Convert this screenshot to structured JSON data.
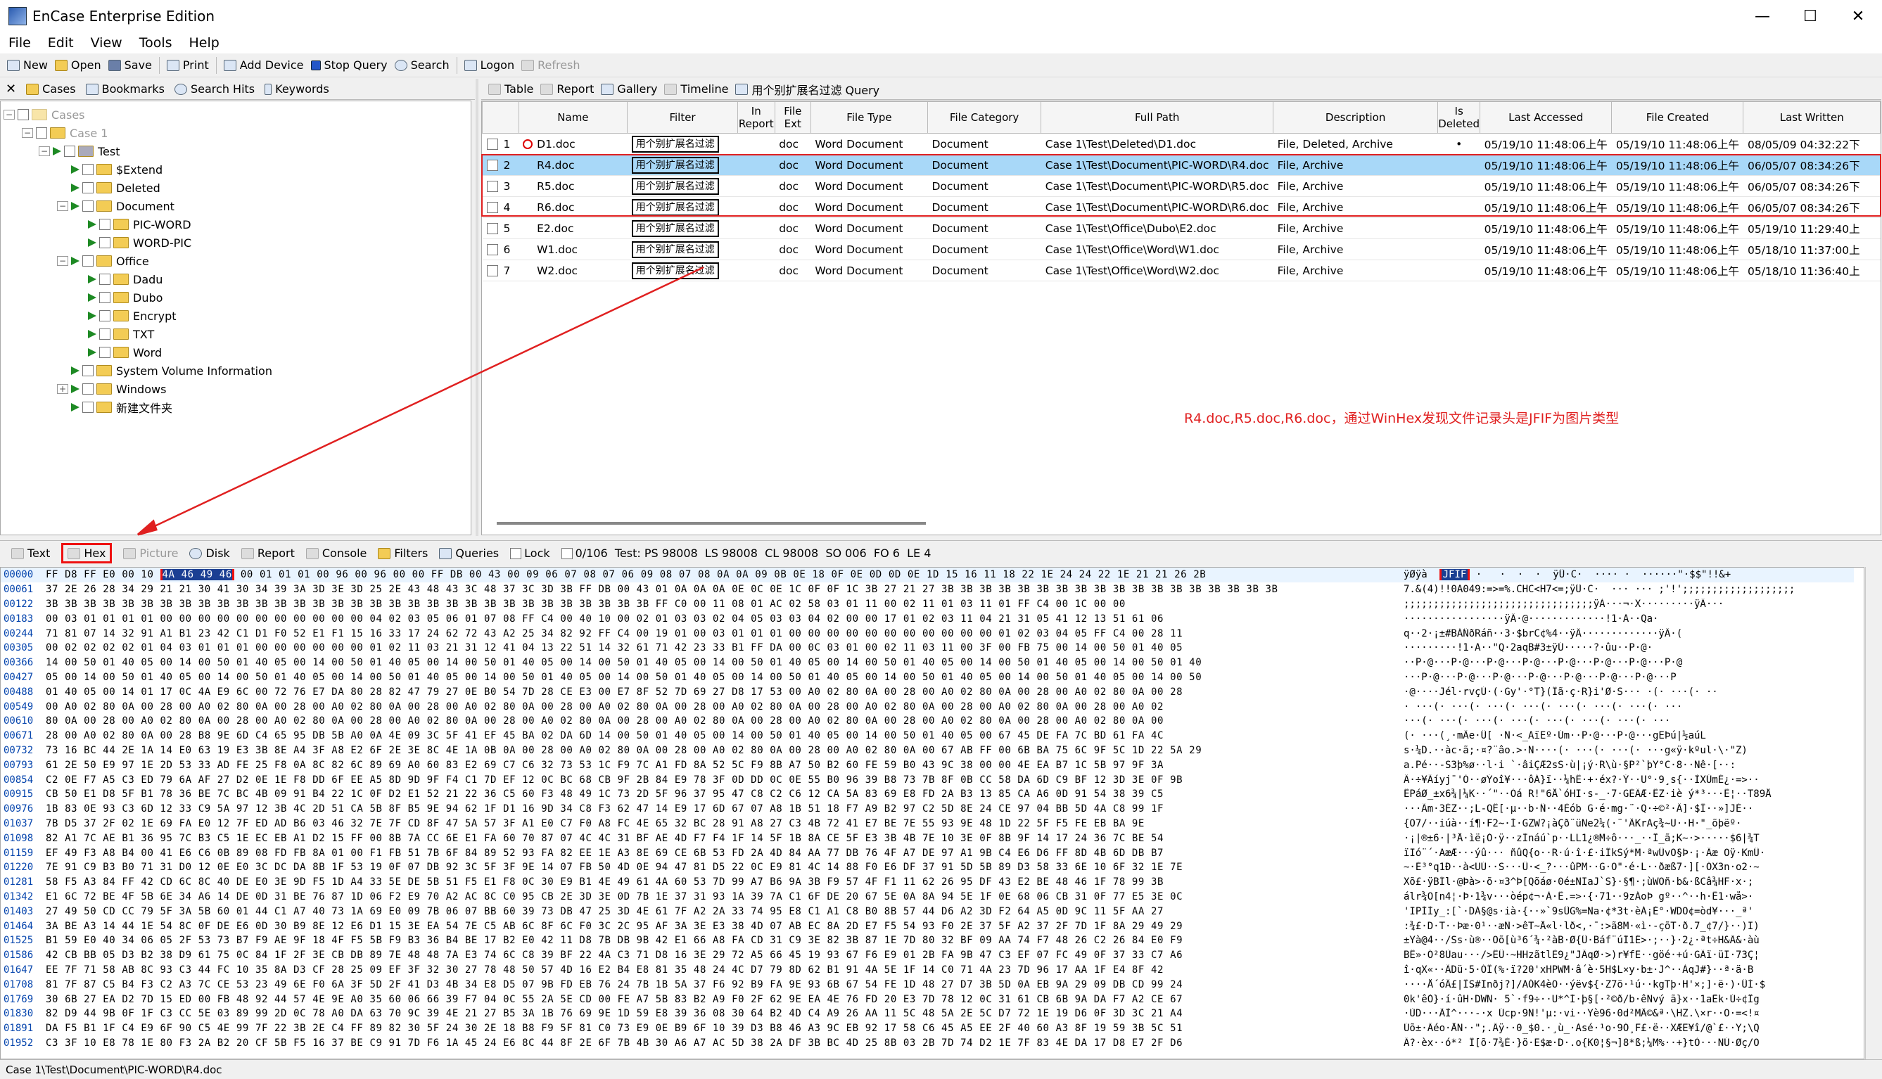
{
  "window": {
    "title": "EnCase Enterprise Edition"
  },
  "menu": [
    "File",
    "Edit",
    "View",
    "Tools",
    "Help"
  ],
  "toolbar": {
    "new": "New",
    "open": "Open",
    "save": "Save",
    "print": "Print",
    "add_device": "Add Device",
    "stop_query": "Stop Query",
    "search": "Search",
    "logon": "Logon",
    "refresh": "Refresh"
  },
  "left_tabs": {
    "cases": "Cases",
    "bookmarks": "Bookmarks",
    "search_hits": "Search Hits",
    "keywords": "Keywords"
  },
  "tree": [
    {
      "label": "Cases",
      "dim": true
    },
    {
      "label": "Case 1",
      "dim": true
    },
    {
      "label": "Test"
    },
    {
      "label": "$Extend"
    },
    {
      "label": "Deleted"
    },
    {
      "label": "Document"
    },
    {
      "label": "PIC-WORD"
    },
    {
      "label": "WORD-PIC"
    },
    {
      "label": "Office"
    },
    {
      "label": "Dadu"
    },
    {
      "label": "Dubo"
    },
    {
      "label": "Encrypt"
    },
    {
      "label": "TXT"
    },
    {
      "label": "Word"
    },
    {
      "label": "System Volume Information"
    },
    {
      "label": "Windows"
    },
    {
      "label": "新建文件夹"
    }
  ],
  "right_tabs": {
    "table": "Table",
    "report": "Report",
    "gallery": "Gallery",
    "timeline": "Timeline",
    "query": "用个别扩展名过滤 Query"
  },
  "columns": [
    "",
    "Name",
    "Filter",
    "In Report",
    "File Ext",
    "File Type",
    "File Category",
    "Full Path",
    "Description",
    "Is Deleted",
    "Last Accessed",
    "File Created",
    "Last Written"
  ],
  "rows": [
    {
      "n": "1",
      "name": "D1.doc",
      "filter": "用个别扩展名过滤",
      "ext": "doc",
      "type": "Word Document",
      "cat": "Document",
      "path": "Case 1\\Test\\Deleted\\D1.doc",
      "desc": "File, Deleted, Archive",
      "del": "•",
      "acc": "05/19/10 11:48:06上午",
      "cre": "05/19/10 11:48:06上午",
      "wri": "08/05/09 04:32:22下"
    },
    {
      "n": "2",
      "name": "R4.doc",
      "filter": "用个别扩展名过滤",
      "ext": "doc",
      "type": "Word Document",
      "cat": "Document",
      "path": "Case 1\\Test\\Document\\PIC-WORD\\R4.doc",
      "desc": "File, Archive",
      "del": "",
      "acc": "05/19/10 11:48:06上午",
      "cre": "05/19/10 11:48:06上午",
      "wri": "06/05/07 08:34:26下"
    },
    {
      "n": "3",
      "name": "R5.doc",
      "filter": "用个别扩展名过滤",
      "ext": "doc",
      "type": "Word Document",
      "cat": "Document",
      "path": "Case 1\\Test\\Document\\PIC-WORD\\R5.doc",
      "desc": "File, Archive",
      "del": "",
      "acc": "05/19/10 11:48:06上午",
      "cre": "05/19/10 11:48:06上午",
      "wri": "06/05/07 08:34:26下"
    },
    {
      "n": "4",
      "name": "R6.doc",
      "filter": "用个别扩展名过滤",
      "ext": "doc",
      "type": "Word Document",
      "cat": "Document",
      "path": "Case 1\\Test\\Document\\PIC-WORD\\R6.doc",
      "desc": "File, Archive",
      "del": "",
      "acc": "05/19/10 11:48:06上午",
      "cre": "05/19/10 11:48:06上午",
      "wri": "06/05/07 08:34:26下"
    },
    {
      "n": "5",
      "name": "E2.doc",
      "filter": "用个别扩展名过滤",
      "ext": "doc",
      "type": "Word Document",
      "cat": "Document",
      "path": "Case 1\\Test\\Office\\Dubo\\E2.doc",
      "desc": "File, Archive",
      "del": "",
      "acc": "05/19/10 11:48:06上午",
      "cre": "05/19/10 11:48:06上午",
      "wri": "05/19/10 11:29:40上"
    },
    {
      "n": "6",
      "name": "W1.doc",
      "filter": "用个别扩展名过滤",
      "ext": "doc",
      "type": "Word Document",
      "cat": "Document",
      "path": "Case 1\\Test\\Office\\Word\\W1.doc",
      "desc": "File, Archive",
      "del": "",
      "acc": "05/19/10 11:48:06上午",
      "cre": "05/19/10 11:48:06上午",
      "wri": "05/18/10 11:37:00上"
    },
    {
      "n": "7",
      "name": "W2.doc",
      "filter": "用个别扩展名过滤",
      "ext": "doc",
      "type": "Word Document",
      "cat": "Document",
      "path": "Case 1\\Test\\Office\\Word\\W2.doc",
      "desc": "File, Archive",
      "del": "",
      "acc": "05/19/10 11:48:06上午",
      "cre": "05/19/10 11:48:06上午",
      "wri": "05/18/10 11:36:40上"
    }
  ],
  "annotation": "R4.doc,R5.doc,R6.doc，通过WinHex发现文件记录头是JFIF为图片类型",
  "bottom_tabs": {
    "text": "Text",
    "hex": "Hex",
    "picture": "Picture",
    "disk": "Disk",
    "report": "Report",
    "console": "Console",
    "filters": "Filters",
    "queries": "Queries",
    "lock": "Lock",
    "status": "0/106  Test: PS 98008  LS 98008  CL 98008  SO 006  FO 6  LE 4"
  },
  "hex": {
    "first_row": {
      "off": "00000",
      "pre": "FF D8 FF E0 00 10 ",
      "hl": "4A 46 49 46",
      "post": " 00 01 01 01 00 96 00 96 00 00 FF DB 00 43 00 09 06 07 08 07 06 09 08 07 08 0A 0A 09 0B 0E 18 0F 0E 0D 0D 0E 1D 15 16 11 18 22 1E 24 24 22 1E 21 21 26 2B",
      "asc_pre": "ÿØÿà  ",
      "asc_hl": "JFIF",
      "asc_post": " ·   ·  ·  ·  ÿÛ·C·  ···· ·  ······\"·$$\"!!&+"
    },
    "rows": [
      {
        "off": "00061",
        "b": "37 2E 26 28 34 29 21 21 30 41 30 34 39 3A 3D 3E 3D 25 2E 43 48 43 3C 48 37 3C 3D 3B FF DB 00 43 01 0A 0A 0A 0E 0C 0E 1C 0F 0F 1C 3B 27 21 27 3B 3B 3B 3B 3B 3B 3B 3B 3B 3B 3B 3B 3B 3B 3B 3B 3B 3B",
        "a": "7.&(4)!!0A049:=>=%.CHC<H7<=;ÿÛ·C·  ··· ··· ;'!';;;;;;;;;;;;;;;;;;;"
      },
      {
        "off": "00122",
        "b": "3B 3B 3B 3B 3B 3B 3B 3B 3B 3B 3B 3B 3B 3B 3B 3B 3B 3B 3B 3B 3B 3B 3B 3B 3B 3B 3B 3B 3B 3B 3B 3B FF C0 00 11 08 01 AC 02 58 03 01 11 00 02 11 01 03 11 01 FF C4 00 1C 00 00",
        "a": ";;;;;;;;;;;;;;;;;;;;;;;;;;;;;;;;ÿÀ···¬·X·········ÿÄ···"
      },
      {
        "off": "00183",
        "b": "00 03 01 01 01 01 00 00 00 00 00 00 00 00 00 00 00 04 02 03 05 06 01 07 08 FF C4 00 40 10 00 02 01 03 03 02 04 05 03 03 04 02 00 00 17 01 02 03 11 04 21 31 05 41 12 13 51 61 06",
        "a": "·················ÿÄ·@·············!1·A··Qa·"
      },
      {
        "off": "00244",
        "b": "71 81 07 14 32 91 A1 B1 23 42 C1 D1 F0 52 E1 F1 15 16 33 17 24 62 72 43 A2 25 34 82 92 FF C4 00 19 01 00 03 01 01 01 00 00 00 00 00 00 00 00 00 00 00 01 02 03 04 05 FF C4 00 28 11",
        "a": "q··2·¡±#BÁÑðRáñ··3·$brC¢%4··ÿÄ·············ÿÄ·("
      },
      {
        "off": "00305",
        "b": "00 02 02 02 02 01 04 03 01 01 01 00 00 00 00 00 00 01 02 11 03 21 31 12 41 04 13 22 51 14 32 61 71 42 23 33 B1 FF DA 00 0C 03 01 00 02 11 03 11 00 3F 00 FB 75 00 14 00 50 01 40 05",
        "a": "·········!1·A··\"Q·2aqB#3±ÿÚ·····?·ûu··P·@·"
      },
      {
        "off": "00366",
        "b": "14 00 50 01 40 05 00 14 00 50 01 40 05 00 14 00 50 01 40 05 00 14 00 50 01 40 05 00 14 00 50 01 40 05 00 14 00 50 01 40 05 00 14 00 50 01 40 05 00 14 00 50 01 40 05 00 14 00 50 01 40",
        "a": "··P·@···P·@···P·@···P·@···P·@···P·@···P·@···P·@"
      },
      {
        "off": "00427",
        "b": "05 00 14 00 50 01 40 05 00 14 00 50 01 40 05 00 14 00 50 01 40 05 00 14 00 50 01 40 05 00 14 00 50 01 40 05 00 14 00 50 01 40 05 00 14 00 50 01 40 05 00 14 00 50 01 40 05 00 14 00 50",
        "a": "···P·@···P·@···P·@···P·@···P·@···P·@···P·@···P"
      },
      {
        "off": "00488",
        "b": "01 40 05 00 14 01 17 0C 4A E9 6C 00 72 76 E7 DA 80 28 82 47 79 27 0E B0 54 7D 28 CE E3 00 E7 8F 52 7D 69 27 D8 17 53 00 A0 02 80 0A 00 28 00 A0 02 80 0A 00 28 00 A0 02 80 0A 00 28",
        "a": "·@····Jél·rvçÚ·(·Gy'·°T}(Îã·ç·R}i'Ø·S··· ·(· ···(· ··"
      },
      {
        "off": "00549",
        "b": "00 A0 02 80 0A 00 28 00 A0 02 80 0A 00 28 00 A0 02 80 0A 00 28 00 A0 02 80 0A 00 28 00 A0 02 80 0A 00 28 00 A0 02 80 0A 00 28 00 A0 02 80 0A 00 28 00 A0 02 80 0A 00 28 00 A0 02",
        "a": "· ···(· ···(· ···(· ···(· ···(· ···(· ···(· ···"
      },
      {
        "off": "00610",
        "b": "80 0A 00 28 00 A0 02 80 0A 00 28 00 A0 02 80 0A 00 28 00 A0 02 80 0A 00 28 00 A0 02 80 0A 00 28 00 A0 02 80 0A 00 28 00 A0 02 80 0A 00 28 00 A0 02 80 0A 00 28 00 A0 02 80 0A 00",
        "a": "···(· ···(· ···(· ···(· ···(· ···(· ···(· ···"
      },
      {
        "off": "00671",
        "b": "28 00 A0 02 80 0A 00 28 B8 9E 6D C4 65 95 DB 5B A0 0A 4E 09 3C 5F 41 EF 45 BA 02 DA 6D 14 00 50 01 40 05 00 14 00 50 01 40 05 00 14 00 50 01 40 05 00 67 45 DE FA 7C BD 61 FA 4C",
        "a": "(· ···(¸·mÄe·Û[ ·N·<_AïEº·Úm··P·@···P·@···gEÞú|½aúL"
      },
      {
        "off": "00732",
        "b": "73 16 BC 44 2E 1A 14 E0 63 19 E3 3B 8E A4 3F A8 E2 6F 2E 3E 8C 4E 1A 0B 0A 00 28 00 A0 02 80 0A 00 28 00 A0 02 80 0A 00 28 00 A0 02 80 0A 00 67 AB FF 00 6B BA 75 6C 9F 5C 1D 22 5A 29",
        "a": "s·¼D.··àc·ã;·¤?¨âo.>·N····(· ···(· ···(· ···g«ÿ·kºul·\\·\"Z)"
      },
      {
        "off": "00793",
        "b": "61 2E 50 E9 97 1E 2D 53 33 AD FE 25 F8 0A 8C 82 6C 89 69 A0 60 83 E2 69 C7 C6 32 73 53 1C F9 7C A1 FD 8A 52 5C F9 8B A7 50 B2 60 FE 59 B0 43 9C 38 00 00 4E EA B7 1C 5B 97 9F 3A",
        "a": "a.Pé··-S3­þ%ø··l·i `·âiÇÆ2sS·ù|¡ý·R\\ù·§P²`þY°C·8··Nê·[··:"
      },
      {
        "off": "00854",
        "b": "C2 0E F7 A5 C3 ED 79 6A AF 27 D2 0E 1E F8 DD 6F EE A5 8D 9D 9F F4 C1 7D EF 12 0C BC 68 CB 9F 2B 84 E9 78 3F 0D DD 0C 0E 55 B0 96 39 B8 73 7B 8F 0B CC 58 DA 6D C9 BF 12 3D 3E 0F 9B",
        "a": "Â·÷¥Ãíyj¯'Ò··øÝoî¥···ôÁ}ï··¼hË·+·éx?·Ý··U°·9¸s{··ÌXÚmÉ¿·=>··"
      },
      {
        "off": "00915",
        "b": "CB 50 E1 D8 5F B1 78 36 BE 7C BC 4B 09 91 B4 22 1C 0F D2 E1 52 21 22 36 C5 60 F3 48 49 1C 73 2D 5F 96 37 95 47 C8 C2 C6 12 CA 5A 83 69 E8 FD 2A B3 13 85 CA A6 0D 91 54 38 39 C5",
        "a": "ËPáØ_±x6¾|¼K··´\"··Òá R!\"6Å`óHI·s-_·7·GÈÂÆ·ÊZ·iè ý*³···Ê¦··T89Å"
      },
      {
        "off": "00976",
        "b": "1B 83 0E 93 C3 6D 12 33 C9 5A 97 12 3B 4C 2D 51 CA 5B 8F B5 9E 94 62 1F D1 16 9D 34 C8 F3 62 47 14 E9 17 6D 67 07 A8 1B 51 18 F7 A9 B2 97 C2 5D 8E 24 CE 97 04 BB 5D 4A C8 99 1F",
        "a": "···Ãm·3ÉZ··;L-QÊ[·µ··b·Ñ··4Èób G·é·mg·¨·Q·÷©²·Â]·$Î··»]JÈ··"
      },
      {
        "off": "01037",
        "b": "7B D5 37 2F 02 1E 69 FA E0 12 7F ED AD B6 03 46 32 7E 7F CD 8F 47 5A 57 3F A1 E0 C7 F0 A8 FC 4E 65 32 BC 28 91 A8 27 C3 4B 72 41 E7 BE 7E 55 93 9E 48 1D 22 5F F5 FE EB BA 9E",
        "a": "{Õ7/··iúà··í­¶·F2~·Í·GZW?¡àÇð¨üNe2¼(·¨'ÃKrAç¾~U··H·\"_õþëº·"
      },
      {
        "off": "01098",
        "b": "82 A1 7C AE B1 36 95 7C B3 C5 1E EC EB A1 D2 15 FF 00 8B 7A CC 6E E1 FA 60 70 87 07 4C 4C 31 BF AE 4D F7 F4 1F 14 5F 1B 8A CE 5F E3 3B 4B 7E 10 3E 0F 8B 9F 14 17 24 36 7C BE 54",
        "a": "·¡|®±6·|³Å·ìë¡Ò·ÿ··zÌnáú`p··LL1¿®M÷ô···_··Î_ã;K~·>·····$6|¾T"
      },
      {
        "off": "01159",
        "b": "EF 49 F3 A8 B4 00 41 E6 C6 0B 89 08 FD FB 8A 01 00 F1 FB 51 7B 6F 84 89 52 93 FA 82 EE 1E A3 8E 69 CE 6B 53 FD 2A 4D 84 AA 77 DB 76 4F A7 DE 97 A1 9B C4 E6 D6 FF 8D 4B 6D DB B7",
        "a": "ïIó¨´·AæÆ···ýû··· ñûQ{o··R·ú·î·£·iÎkSý*M·ªwÛvO§Þ·¡·Äæ Öÿ·KmÛ·"
      },
      {
        "off": "01220",
        "b": "7E 91 C9 B3 B0 71 31 D0 12 0E E0 3C DC DA 8B 1F 53 19 0F 07 DB 92 3C 5F 3F 9E 14 07 FB 50 4D 0E 94 47 81 D5 22 0C E9 81 4C 14 88 F0 E6 DF 37 91 5D 5B 89 D3 58 33 6E 10 6F 32 1E 7E",
        "a": "~·É³°q1Ð··à<ÜÚ··S···Û·<_?···ûPM··G·Õ\"·é·L··ðæß7·][·ÓX3n·o2·~"
      },
      {
        "off": "01281",
        "b": "58 F5 A3 84 FF 42 CD 6C 8C 40 DE E0 3E 9D F5 1D A4 33 5E DE 5B 51 F5 E1 F8 0C 30 E9 B1 4E 49 61 4A 60 53 7D 99 A7 B6 9A 3B F9 57 4F F1 11 62 26 95 DF 43 E2 BE 48 46 1F 78 99 3B",
        "a": "Xõ£·ÿBÍl·@Þà>·õ·¤3^Þ[Qõáø·0é±NIaJ`S}·§¶·;ùWOñ·b&·ßCâ¾HF·x·;"
      },
      {
        "off": "01342",
        "b": "E1 6C 72 BE 4F 5B 6E 34 A6 14 DE 0D 31 BE 76 87 1D 06 F2 E9 70 A2 AC 8C C0 95 CB 2E 3D 3E 0D 7B 1E 37 31 93 1A 39 7A C1 6F DE 20 67 5E 0A 8A 94 5E 1F 0E 68 06 CB 31 0F 77 E5 3E 0C",
        "a": "álr¾O[n4¦·Þ·1¾v···òép¢¬·À·Ë.=>·{·71··9zÁoÞ gº··^··h·Ë1·wå>·"
      },
      {
        "off": "01403",
        "b": "27 49 50 CD CC 79 5F 3A 5B 60 01 44 C1 A7 40 73 1A 69 E0 09 7B 06 07 BB 60 39 73 DB 47 25 3D 4E 61 7F A2 2A 33 74 95 E8 C1 A1 C8 B0 8B 57 44 D6 A2 3D F2 64 A5 0D 9C 11 5F AA 27",
        "a": "'IPÍÌy_:[`·DÁ§@s·ià·{··»`9sÛG%=Na·¢*3t·èÁ¡È°·WDÖ¢=òd¥···_ª'"
      },
      {
        "off": "01464",
        "b": "3A BE A3 14 44 1E 54 8C 0F DE E6 0D 30 B9 8E 12 E6 D1 15 3E EA 54 7E C5 AB 6C 8F 6C F0 3C 2C 95 AF 3A 3E E3 38 4D 07 AB EC 8A 2D E7 F5 54 93 F0 2E 37 5F A2 37 2F 7D 1F 8A 29 49 29",
        "a": ":¾£·D·T··Þæ·0¹··æÑ·>êT~Å«l·lð<,·¯:>ã8M·«ì·-çõT·ð.7_¢7/}··)I)"
      },
      {
        "off": "01525",
        "b": "B1 59 E0 40 34 06 05 2F 53 73 B7 F9 AE 9F 18 4F F5 5B F9 B3 36 B4 BE 17 B2 E0 42 11 D8 7B DB 9B 42 E1 66 A8 FA CD 31 C9 3E 82 3B 87 1E 7D 80 32 BF 09 AA 74 F7 48 26 C2 26 84 E0 F9",
        "a": "±Yà@4··/Ss·ù®··Oõ[ù³6´¾·²àB·Ø{Û·Báf¨úÍ1É>·;··}·2¿·ªt÷H&Â&·àù"
      },
      {
        "off": "01586",
        "b": "42 CB BB 05 D3 B2 38 D9 61 75 0C 84 1F 2F 3E CB DB 89 7E 48 48 7A E3 74 6C C8 39 BF 22 4A C3 71 D8 16 3E 29 72 A5 66 45 19 93 67 F6 E9 01 2B FA 9B 47 C3 EF 07 FC 49 0F 37 33 C7 A6",
        "a": "BË»·Ó²8Ùau···/>ËÛ·~HHzãtlÈ9¿\"JÃqØ·>)r¥fE··göé·+ú·GÃï·üI·73Ç¦"
      },
      {
        "off": "01647",
        "b": "EE 7F 71 58 AB 8C 93 C3 44 FC 10 35 8A D3 CF 28 25 09 EF 3F 32 30 27 78 48 50 57 4D 16 E2 B4 E8 81 35 48 24 4C D7 79 8D 62 B1 91 4A 5E 1F 14 C0 71 4A 23 7D 96 17 AA 1F E4 8F 42",
        "a": "î·qX«··ÃDü·5·ÓÏ(%·ï?20'xHPWM·â´è·5H$L×y·b±·J^··ÀqJ#}··ª·ä·B"
      },
      {
        "off": "01708",
        "b": "81 7F 87 C5 B4 F3 C2 A3 7C CE 53 23 49 6E F0 6A 3F 5D 2F 41 D3 4B 34 E8 D5 07 9B FD EB 76 24 7B 1B 5A 37 F6 92 B9 FA 9E 93 6B 67 54 FE 1D 48 27 D7 3B 5D 0A EB 9A 29 09 DB CD 99 24",
        "a": "····Å´óÂ£|ÎS#Inðj?]/AÓK4èÕ··ýëv${·Z7ö·¹ú··kgTþ·H'×;]·ë·)·ÛÍ·$"
      },
      {
        "off": "01769",
        "b": "30 6B 27 EA D2 7D 15 ED 00 FB 48 92 44 57 4E 9E A0 35 60 06 66 39 F7 04 0C 55 2A 5E CD 00 FE A7 5B 83 B2 A9 F0 2F 62 9E EA 4E 76 FD 20 E3 7D 78 12 0C 31 61 CB 6B 9A DA F7 A2 CE 67",
        "a": "0k'êÒ}·í·ûH·DWN· 5`·f9÷··U*^Í·þ§[·²©ð/b·êNvý ã}x··1aËk·Ú÷¢Îg"
      },
      {
        "off": "01830",
        "b": "82 D9 44 9B 0F 1F C3 CC 5E 03 89 99 2D 0C 78 A0 DA 63 70 9C 39 4E 21 27 B5 3A 1B 76 69 9E 1D 59 E8 39 36 08 30 64 B2 4D C4 A9 26 AA 11 5C 48 5A 2E 5C D7 72 1E 19 D6 0F 3D 3C 21 A4",
        "a": "·ÙD···ÃÌ^···-·x Úcp·9N!'µ:·vi··Yè96·0d²MÄ©&ª·\\HZ.\\×r··Ö·=<!¤"
      },
      {
        "off": "01891",
        "b": "DA F5 B1 1F C4 E9 6F 90 C5 4E 99 7F 22 3B 2E C4 FF 89 82 30 5F 24 30 2E 18 B8 F9 5F 81 C0 73 E9 0E B9 6F 10 39 D3 B8 46 A3 9C EB 92 17 58 C6 45 A5 EE 2F 40 60 A3 8F 19 59 3B 5C 51",
        "a": "Úõ±·Äéo·ÅN··\";.Äÿ··0_$0.·¸ù_·Àsé·¹o·9Ó¸F£·ë··XÆE¥î/@`£··Y;\\Q"
      },
      {
        "off": "01952",
        "b": "C3 3F 10 E8 78 1E 80 F3 2A B2 20 CF 5B F5 16 37 BE C9 91 7D F6 1A 45 24 E6 8C 44 8F 2E 6F 7B 4B 30 A6 A7 AC 5D 38 2A DF 3B BC 4D 25 8B 03 2B 7D 74 D2 1E 7F 83 4E DA 17 D8 E7 2F D6",
        "a": "Ã?·èx··ó*² Ï[õ·7¾É·}ö·E$æ·D·.o{K0¦§¬]8*ß;¼M%··+}tÒ···NÚ·Øç/Ö"
      }
    ]
  },
  "status": {
    "path": "Case 1\\Test\\Document\\PIC-WORD\\R4.doc"
  }
}
